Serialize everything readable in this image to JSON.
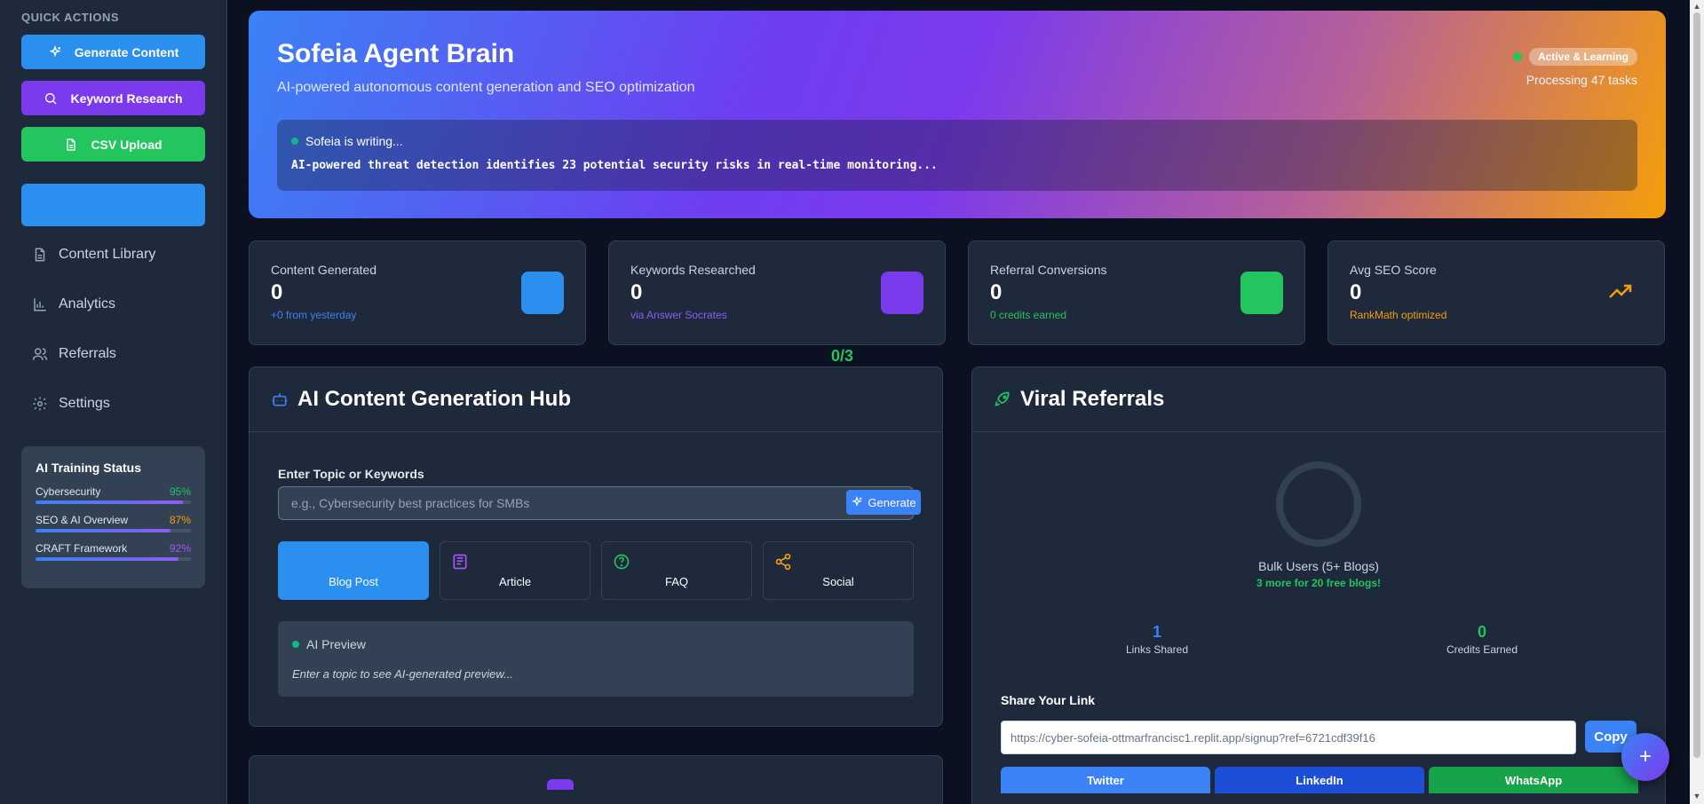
{
  "sidebar": {
    "quick_actions_title": "QUICK ACTIONS",
    "actions": [
      {
        "label": "Generate Content",
        "color": "#2b8ff0",
        "icon": "sparkles-icon"
      },
      {
        "label": "Keyword Research",
        "color": "#7c3aed",
        "icon": "search-icon"
      },
      {
        "label": "CSV Upload",
        "color": "#22c55e",
        "icon": "file-icon"
      },
      {
        "label": "",
        "color": "#2b8ff0",
        "icon": ""
      }
    ],
    "nav": [
      {
        "label": "Content Library",
        "icon": "document-icon"
      },
      {
        "label": "Analytics",
        "icon": "bar-chart-icon"
      },
      {
        "label": "Referrals",
        "icon": "users-icon"
      },
      {
        "label": "Settings",
        "icon": "gear-icon"
      }
    ],
    "training": {
      "title": "AI Training Status",
      "items": [
        {
          "name": "Cybersecurity",
          "pct": "95%",
          "value": 0.95,
          "color": "#22c55e"
        },
        {
          "name": "SEO & AI Overview",
          "pct": "87%",
          "value": 0.87,
          "color": "#f59e0b"
        },
        {
          "name": "CRAFT Framework",
          "pct": "92%",
          "value": 0.92,
          "color": "#a855f7"
        }
      ]
    }
  },
  "hero": {
    "title": "Sofeia Agent Brain",
    "subtitle": "AI-powered autonomous content generation and SEO optimization",
    "status_badge": "Active & Learning",
    "processing": "Processing 47 tasks",
    "writing_label": "Sofeia is writing...",
    "writing_text": "AI-powered threat detection identifies 23 potential security risks in real-time monitoring..."
  },
  "stats": [
    {
      "label": "Content Generated",
      "value": "0",
      "note": "+0 from yesterday",
      "note_color": "#3b82f6",
      "accent": "#2b8ff0"
    },
    {
      "label": "Keywords Researched",
      "value": "0",
      "note": "via Answer Socrates",
      "note_color": "#8b5cf6",
      "accent": "#7c3aed"
    },
    {
      "label": "Referral Conversions",
      "value": "0",
      "note": "0 credits earned",
      "note_color": "#22c55e",
      "accent": "#22c55e"
    },
    {
      "label": "Avg SEO Score",
      "value": "0",
      "note": "RankMath optimized",
      "note_color": "#f59e0b",
      "accent": "#f59e0b"
    }
  ],
  "ratio": "0/3",
  "content_hub": {
    "title": "AI Content Generation Hub",
    "field_label": "Enter Topic or Keywords",
    "placeholder": "e.g., Cybersecurity best practices for SMBs",
    "generate_label": "Generate",
    "types": [
      {
        "label": "Blog Post",
        "icon": "",
        "active": true
      },
      {
        "label": "Article",
        "icon": "newspaper-icon",
        "icon_color": "#a855f7"
      },
      {
        "label": "FAQ",
        "icon": "help-circle-icon",
        "icon_color": "#22c55e"
      },
      {
        "label": "Social",
        "icon": "share-icon",
        "icon_color": "#f59e0b"
      }
    ],
    "preview_title": "AI Preview",
    "preview_text": "Enter a topic to see AI-generated preview..."
  },
  "referrals": {
    "title": "Viral Referrals",
    "bulk_label": "Bulk Users (5+ Blogs)",
    "bulk_note": "3 more for 20 free blogs!",
    "links_shared_value": "1",
    "links_shared_label": "Links Shared",
    "credits_value": "0",
    "credits_label": "Credits Earned",
    "share_label": "Share Your Link",
    "share_url": "https://cyber-sofeia-ottmarfrancisc1.replit.app/signup?ref=6721cdf39f16",
    "copy_label": "Copy",
    "social_buttons": [
      {
        "label": "Twitter",
        "color": "#3b82f6"
      },
      {
        "label": "LinkedIn",
        "color": "#1d4ed8"
      },
      {
        "label": "WhatsApp",
        "color": "#16a34a"
      }
    ]
  },
  "fab_label": "+"
}
